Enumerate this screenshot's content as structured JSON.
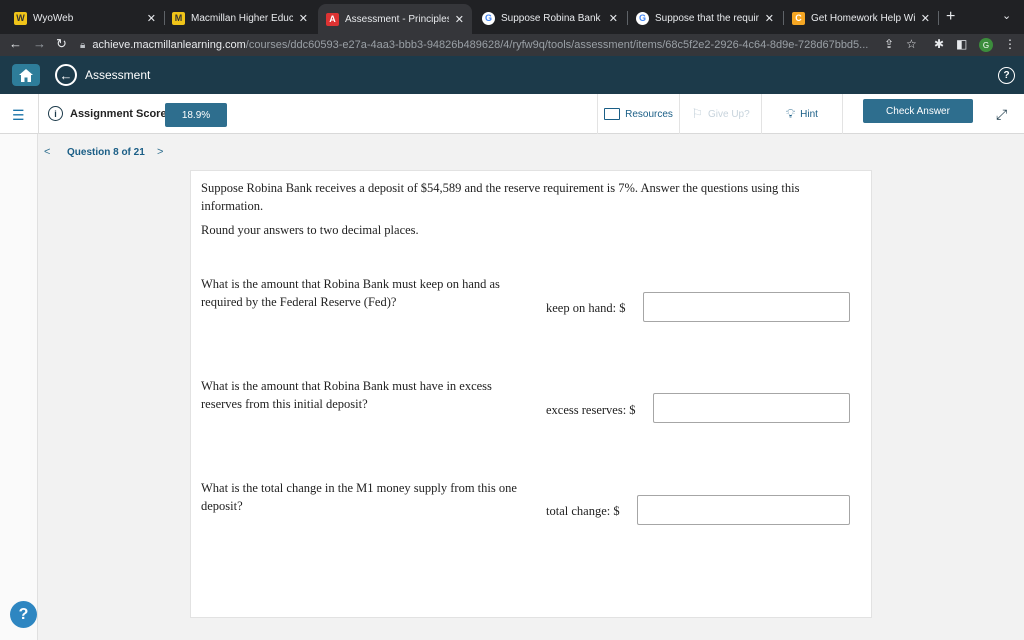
{
  "browser": {
    "tabs": [
      {
        "title": "WyoWeb",
        "favicon": "W"
      },
      {
        "title": "Macmillan Higher Educatio",
        "favicon": "M"
      },
      {
        "title": "Assessment - Principles of",
        "favicon": "A"
      },
      {
        "title": "Suppose Robina Bank rece",
        "favicon": "G"
      },
      {
        "title": "Suppose that the required",
        "favicon": "G"
      },
      {
        "title": "Get Homework Help With C",
        "favicon": "C"
      }
    ],
    "url_host": "achieve.macmillanlearning.com",
    "url_path": "/courses/ddc60593-e27a-4aa3-bbb3-94826b489628/4/ryfw9q/tools/assessment/items/68c5f2e2-2926-4c64-8d9e-728d67bbd5...",
    "profile_initial": "G"
  },
  "app": {
    "title": "Assessment",
    "score_label": "Assignment Score:",
    "score_value": "18.9%",
    "resources_label": "Resources",
    "giveup_label": "Give Up?",
    "hint_label": "Hint",
    "check_label": "Check Answer",
    "question_nav": "Question 8 of 21"
  },
  "question": {
    "intro": "Suppose Robina Bank receives a deposit of $54,589 and the reserve requirement is 7%. Answer the questions using this information.",
    "round": "Round your answers to two decimal places.",
    "parts": [
      {
        "prompt": "What is the amount that Robina Bank must keep on hand as required by the Federal Reserve (Fed)?",
        "label": "keep on hand: $",
        "value": ""
      },
      {
        "prompt": "What is the amount that Robina Bank must have in excess reserves from this initial deposit?",
        "label": "excess reserves: $",
        "value": ""
      },
      {
        "prompt": "What is the total change in the M1 money supply from this one deposit?",
        "label": "total change: $",
        "value": ""
      }
    ]
  },
  "colors": {
    "header": "#1c3a4a",
    "accent": "#2e6e8e"
  }
}
